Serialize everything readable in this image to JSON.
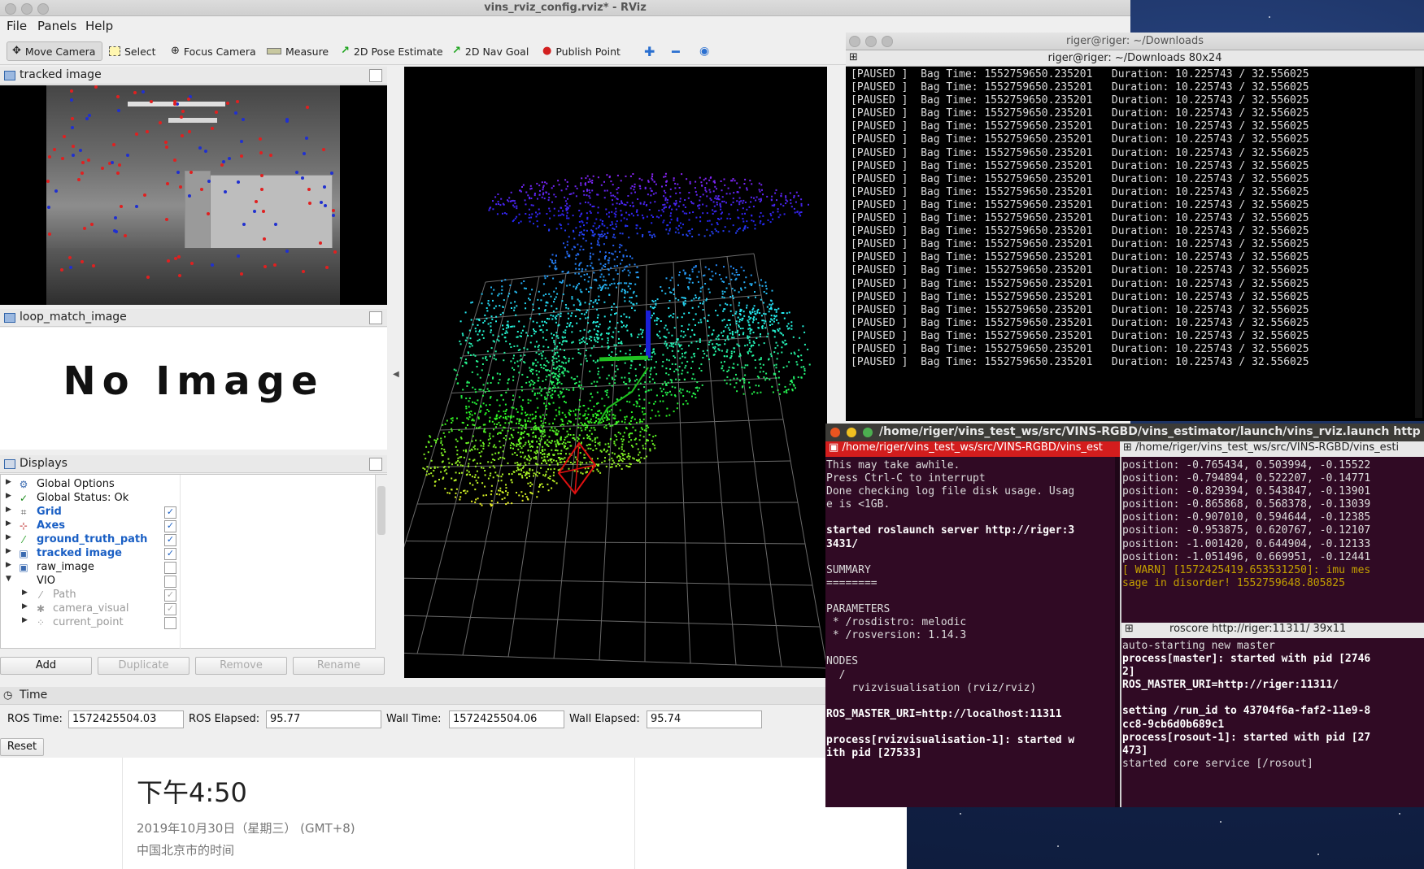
{
  "rviz": {
    "window_title": "vins_rviz_config.rviz* - RViz",
    "menu": [
      "File",
      "Panels",
      "Help"
    ],
    "toolbar": {
      "move_camera": "Move Camera",
      "select": "Select",
      "focus_camera": "Focus Camera",
      "measure": "Measure",
      "pose_estimate": "2D Pose Estimate",
      "nav_goal": "2D Nav Goal",
      "publish_point": "Publish Point"
    },
    "tracked_image_title": "tracked image",
    "loop_match_title": "loop_match_image",
    "no_image_text": "No Image",
    "displays_title": "Displays",
    "displays": [
      {
        "name": "Global Options",
        "style": "normal",
        "checked": null
      },
      {
        "name": "Global Status: Ok",
        "style": "normal",
        "checked": null
      },
      {
        "name": "Grid",
        "style": "blue",
        "checked": true
      },
      {
        "name": "Axes",
        "style": "blue",
        "checked": true
      },
      {
        "name": "ground_truth_path",
        "style": "blue",
        "checked": true
      },
      {
        "name": "tracked image",
        "style": "blue",
        "checked": true
      },
      {
        "name": "raw_image",
        "style": "normal",
        "checked": false
      },
      {
        "name": "VIO",
        "style": "normal",
        "checked": false
      },
      {
        "name": "Path",
        "style": "dim",
        "checked": true
      },
      {
        "name": "camera_visual",
        "style": "dim",
        "checked": true
      },
      {
        "name": "current_point",
        "style": "dim",
        "checked": false
      }
    ],
    "buttons": {
      "add": "Add",
      "duplicate": "Duplicate",
      "remove": "Remove",
      "rename": "Rename"
    },
    "time_panel": {
      "title": "Time",
      "ros_time_label": "ROS Time:",
      "ros_time": "1572425504.03",
      "ros_elapsed_label": "ROS Elapsed:",
      "ros_elapsed": "95.77",
      "wall_time_label": "Wall Time:",
      "wall_time": "1572425504.06",
      "wall_elapsed_label": "Wall Elapsed:",
      "wall_elapsed": "95.74",
      "reset": "Reset"
    }
  },
  "clock": {
    "time": "下午4:50",
    "date": "2019年10月30日（星期三） (GMT+8)",
    "location": "中国北京市的时间"
  },
  "term_rosbag": {
    "title": "riger@riger: ~/Downloads",
    "subtitle": "riger@riger: ~/Downloads 80x24",
    "lines": [
      "[PAUSED ]  Bag Time: 1552759650.235201   Duration: 10.225743 / 32.556025",
      "[PAUSED ]  Bag Time: 1552759650.235201   Duration: 10.225743 / 32.556025",
      "[PAUSED ]  Bag Time: 1552759650.235201   Duration: 10.225743 / 32.556025",
      "[PAUSED ]  Bag Time: 1552759650.235201   Duration: 10.225743 / 32.556025",
      "[PAUSED ]  Bag Time: 1552759650.235201   Duration: 10.225743 / 32.556025",
      "[PAUSED ]  Bag Time: 1552759650.235201   Duration: 10.225743 / 32.556025",
      "[PAUSED ]  Bag Time: 1552759650.235201   Duration: 10.225743 / 32.556025",
      "[PAUSED ]  Bag Time: 1552759650.235201   Duration: 10.225743 / 32.556025",
      "[PAUSED ]  Bag Time: 1552759650.235201   Duration: 10.225743 / 32.556025",
      "[PAUSED ]  Bag Time: 1552759650.235201   Duration: 10.225743 / 32.556025",
      "[PAUSED ]  Bag Time: 1552759650.235201   Duration: 10.225743 / 32.556025",
      "[PAUSED ]  Bag Time: 1552759650.235201   Duration: 10.225743 / 32.556025",
      "[PAUSED ]  Bag Time: 1552759650.235201   Duration: 10.225743 / 32.556025",
      "[PAUSED ]  Bag Time: 1552759650.235201   Duration: 10.225743 / 32.556025",
      "[PAUSED ]  Bag Time: 1552759650.235201   Duration: 10.225743 / 32.556025",
      "[PAUSED ]  Bag Time: 1552759650.235201   Duration: 10.225743 / 32.556025",
      "[PAUSED ]  Bag Time: 1552759650.235201   Duration: 10.225743 / 32.556025",
      "[PAUSED ]  Bag Time: 1552759650.235201   Duration: 10.225743 / 32.556025",
      "[PAUSED ]  Bag Time: 1552759650.235201   Duration: 10.225743 / 32.556025",
      "[PAUSED ]  Bag Time: 1552759650.235201   Duration: 10.225743 / 32.556025",
      "[PAUSED ]  Bag Time: 1552759650.235201   Duration: 10.225743 / 32.556025",
      "[PAUSED ]  Bag Time: 1552759650.235201   Duration: 10.225743 / 32.556025",
      "[PAUSED ]  Bag Time: 1552759650.235201   Duration: 10.225743 / 32.556025"
    ]
  },
  "term_launch": {
    "title": "/home/riger/vins_test_ws/src/VINS-RGBD/vins_estimator/launch/vins_rviz.launch http://lo...",
    "tab1": "/home/riger/vins_test_ws/src/VINS-RGBD/vins_est",
    "tab2": "/home/riger/vins_test_ws/src/VINS-RGBD/vins_esti",
    "left_lines": [
      "This may take awhile.",
      "Press Ctrl-C to interrupt",
      "Done checking log file disk usage. Usag",
      "e is <1GB.",
      "",
      "started roslaunch server http://riger:3",
      "3431/",
      "",
      "SUMMARY",
      "========",
      "",
      "PARAMETERS",
      " * /rosdistro: melodic",
      " * /rosversion: 1.14.3",
      "",
      "NODES",
      "  /",
      "    rvizvisualisation (rviz/rviz)",
      "",
      "ROS_MASTER_URI=http://localhost:11311",
      "",
      "process[rvizvisualisation-1]: started w",
      "ith pid [27533]"
    ],
    "right_lines": [
      "position: -0.765434, 0.503994, -0.15522",
      "position: -0.794894, 0.522207, -0.14771",
      "position: -0.829394, 0.543847, -0.13901",
      "position: -0.865868, 0.568378, -0.13039",
      "position: -0.907010, 0.594644, -0.12385",
      "position: -0.953875, 0.620767, -0.12107",
      "position: -1.001420, 0.644904, -0.12133",
      "position: -1.051496, 0.669951, -0.12441",
      "[ WARN] [1572425419.653531250]: imu mes",
      "sage in disorder! 1552759648.805825"
    ]
  },
  "term_roscore": {
    "title": "roscore http://riger:11311/ 39x11",
    "lines": [
      "auto-starting new master",
      "process[master]: started with pid [2746",
      "2]",
      "ROS_MASTER_URI=http://riger:11311/",
      "",
      "setting /run_id to 43704f6a-faf2-11e9-8",
      "cc8-9cb6d0b689c1",
      "process[rosout-1]: started with pid [27",
      "473]",
      "started core service [/rosout]"
    ]
  },
  "colors": {
    "terminal_bg": "#300a24",
    "bold_text": "#ffffff",
    "warn_text": "#c4a000",
    "display_blue": "#1a5fc4",
    "tab_red": "#d31d1d"
  }
}
